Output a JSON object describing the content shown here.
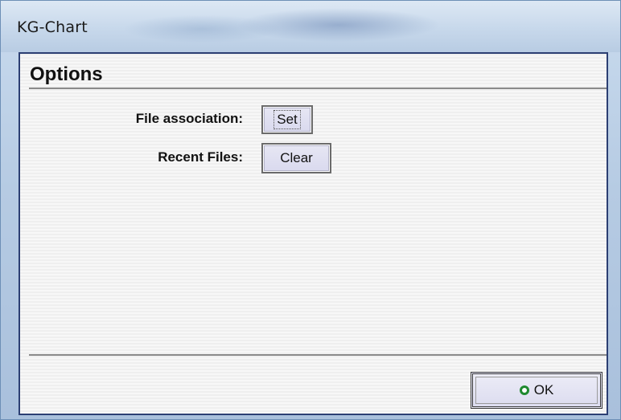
{
  "window": {
    "title": "KG-Chart"
  },
  "dialog": {
    "heading": "Options",
    "options": [
      {
        "label": "File association:",
        "button_label": "Set"
      },
      {
        "label": "Recent Files:",
        "button_label": "Clear"
      }
    ],
    "ok_button": {
      "label": "OK",
      "icon": "ok-circle-icon"
    }
  },
  "colors": {
    "frame_border": "#2c3f73",
    "ok_icon": "#1f8a2f",
    "button_face": "#e0e0f1"
  }
}
